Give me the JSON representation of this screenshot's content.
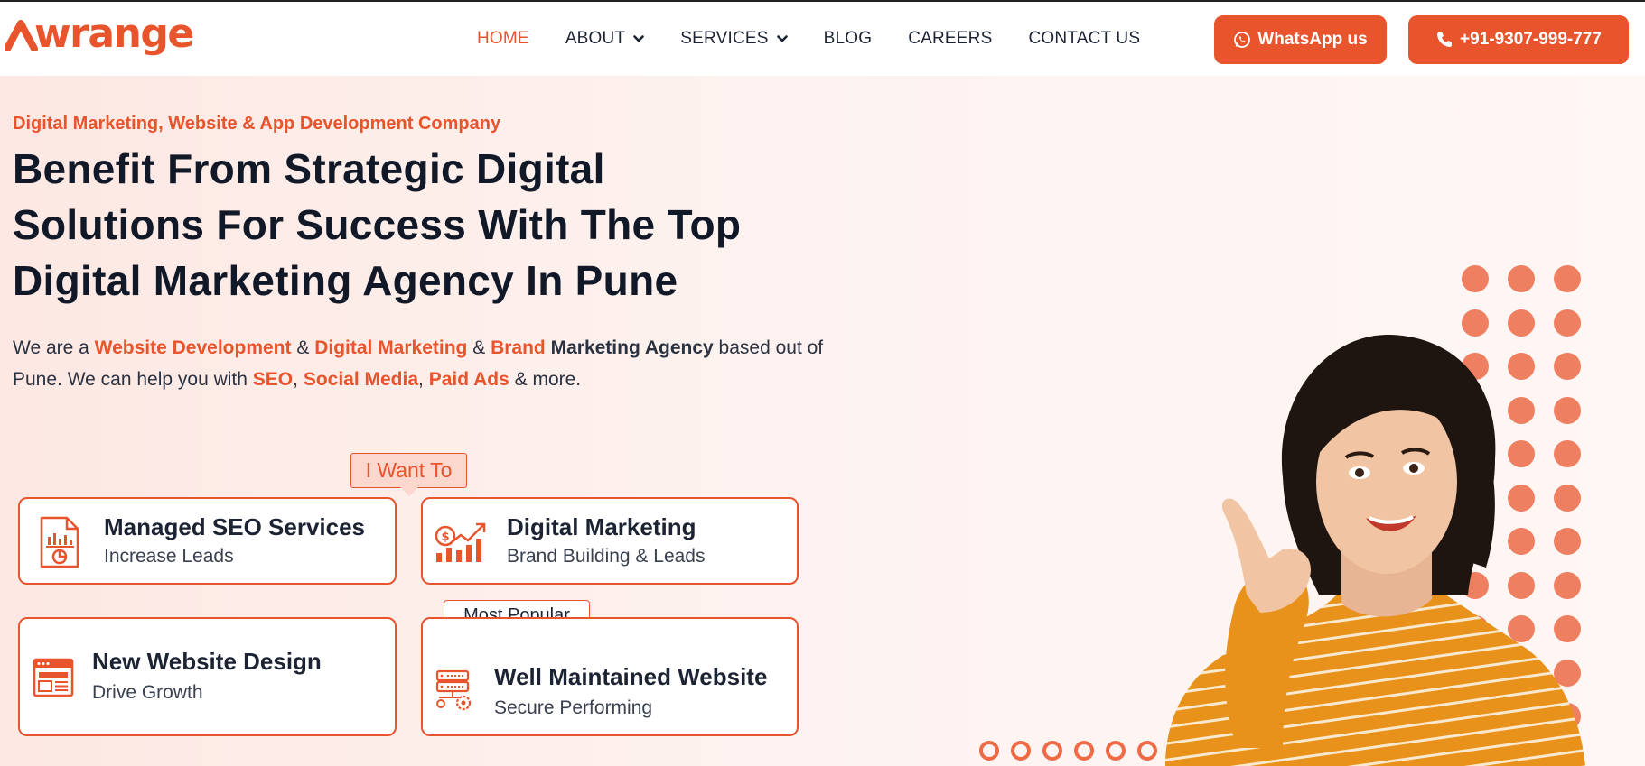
{
  "brand": {
    "name": "Awrange",
    "logo_text": "wrange",
    "color": "#e8542c"
  },
  "nav": [
    {
      "label": "HOME",
      "active": true,
      "dropdown": false
    },
    {
      "label": "ABOUT",
      "active": false,
      "dropdown": true
    },
    {
      "label": "SERVICES",
      "active": false,
      "dropdown": true
    },
    {
      "label": "BLOG",
      "active": false,
      "dropdown": false
    },
    {
      "label": "CAREERS",
      "active": false,
      "dropdown": false
    },
    {
      "label": "CONTACT US",
      "active": false,
      "dropdown": false
    }
  ],
  "cta": {
    "whatsapp_label": "WhatsApp us",
    "phone_label": "+91-9307-999-777"
  },
  "hero": {
    "eyebrow": "Digital Marketing, Website & App Development Company",
    "headline_line1": "Benefit From Strategic Digital",
    "headline_line2": "Solutions For Success With The Top",
    "headline_line3": "Digital Marketing Agency In Pune",
    "lead": {
      "t1": "We are a ",
      "website_development": "Website Development",
      "t2": " & ",
      "digital_marketing": "Digital Marketing",
      "t3": " & ",
      "brand": "Brand",
      "marketing_agency": " Marketing Agency",
      "t4": " based out of Pune. We can help you with ",
      "seo": "SEO",
      "t5": ", ",
      "social_media": "Social Media",
      "t6": ", ",
      "paid_ads": "Paid Ads",
      "t7": " & more."
    },
    "selector_label": "I Want To",
    "cards": [
      {
        "title": "Managed SEO Services",
        "subtitle": "Increase Leads",
        "icon": "seo-report-icon"
      },
      {
        "title": "Digital Marketing",
        "subtitle": "Brand Building & Leads",
        "icon": "growth-chart-icon"
      },
      {
        "title": "New Website Design",
        "subtitle": "Drive Growth",
        "icon": "website-layout-icon"
      },
      {
        "title": "Well Maintained Website",
        "subtitle": "Secure Performing",
        "icon": "server-maintenance-icon"
      }
    ],
    "badge": "Most Popular"
  },
  "colors": {
    "accent": "#e8542c",
    "dot": "#ef7f61",
    "dark_text": "#1c2333",
    "hero_bg": "#fdeee9"
  }
}
